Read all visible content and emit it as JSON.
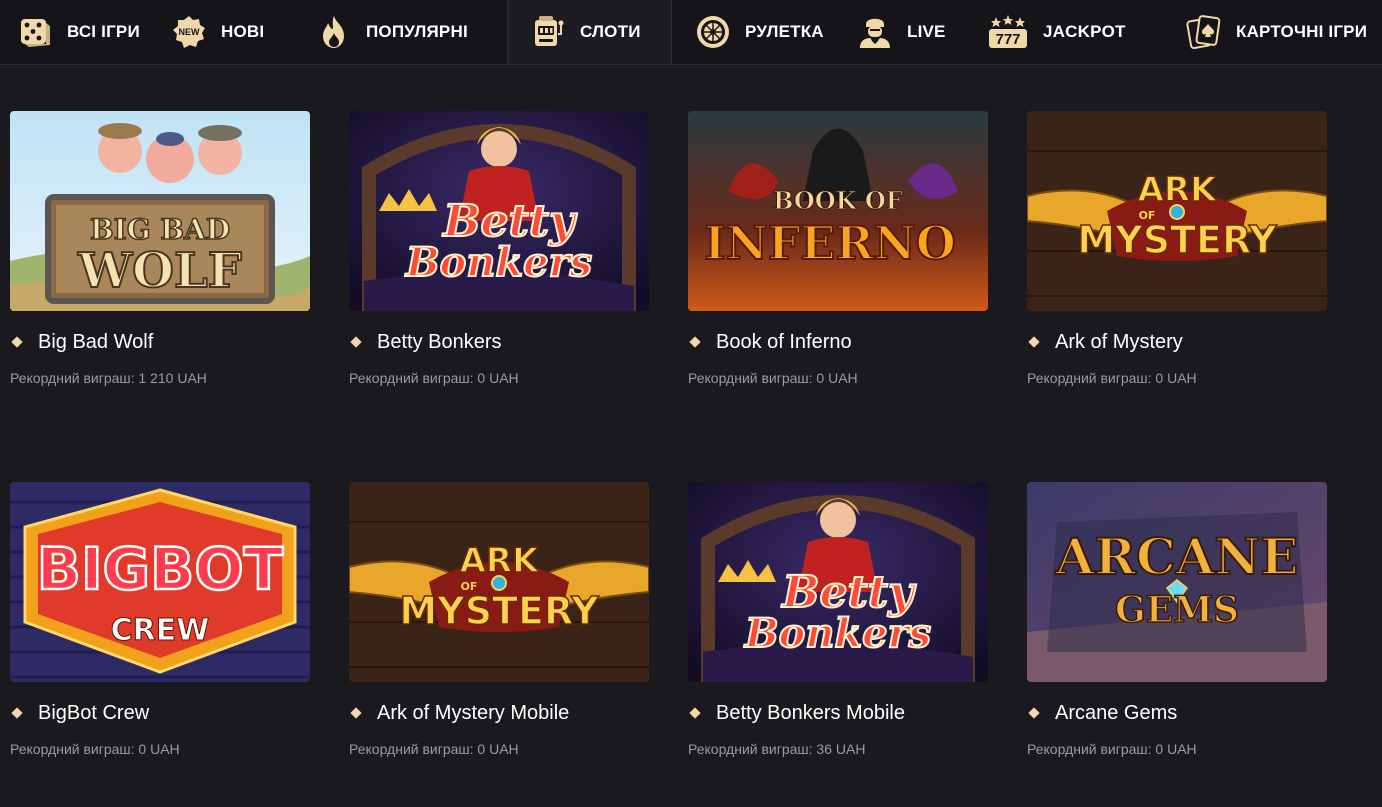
{
  "nav": {
    "items": [
      {
        "label": "ВСІ ІГРИ",
        "icon": "dice-icon"
      },
      {
        "label": "НОВІ",
        "icon": "new-badge-icon",
        "badge": "NEW"
      },
      {
        "label": "ПОПУЛЯРНІ",
        "icon": "fire-icon"
      },
      {
        "label": "СЛОТИ",
        "icon": "slot-machine-icon",
        "active": true
      },
      {
        "label": "РУЛЕТКА",
        "icon": "roulette-icon"
      },
      {
        "label": "LIVE",
        "icon": "dealer-icon"
      },
      {
        "label": "JACKPOT",
        "icon": "jackpot-777-icon",
        "badge": "777"
      },
      {
        "label": "КАРТОЧНІ ІГРИ",
        "icon": "cards-icon"
      }
    ]
  },
  "games": [
    {
      "title": "Big Bad Wolf",
      "record": "Рекордний виграш: 1 210 UAH",
      "art": [
        "BIG BAD",
        "WOLF"
      ]
    },
    {
      "title": "Betty Bonkers",
      "record": "Рекордний виграш: 0 UAH",
      "art": [
        "Betty",
        "Bonkers"
      ]
    },
    {
      "title": "Book of Inferno",
      "record": "Рекордний виграш: 0 UAH",
      "art": [
        "BOOK OF",
        "INFERNO"
      ]
    },
    {
      "title": "Ark of Mystery",
      "record": "Рекордний виграш: 0 UAH",
      "art": [
        "ARK",
        "OF",
        "MYSTERY"
      ]
    },
    {
      "title": "BigBot Crew",
      "record": "Рекордний виграш: 0 UAH",
      "art": [
        "BIGBOT",
        "CREW"
      ]
    },
    {
      "title": "Ark of Mystery Mobile",
      "record": "Рекордний виграш: 0 UAH",
      "art": [
        "ARK",
        "OF",
        "MYSTERY"
      ]
    },
    {
      "title": "Betty Bonkers Mobile",
      "record": "Рекордний виграш: 36 UAH",
      "art": [
        "Betty",
        "Bonkers"
      ]
    },
    {
      "title": "Arcane Gems",
      "record": "Рекордний виграш: 0 UAH",
      "art": [
        "ARCANE",
        "GEMS"
      ]
    }
  ],
  "colors": {
    "accent": "#f1d8a8",
    "background": "#1a191d",
    "nav_bg": "#151418",
    "muted_text": "#9c9aa2"
  }
}
